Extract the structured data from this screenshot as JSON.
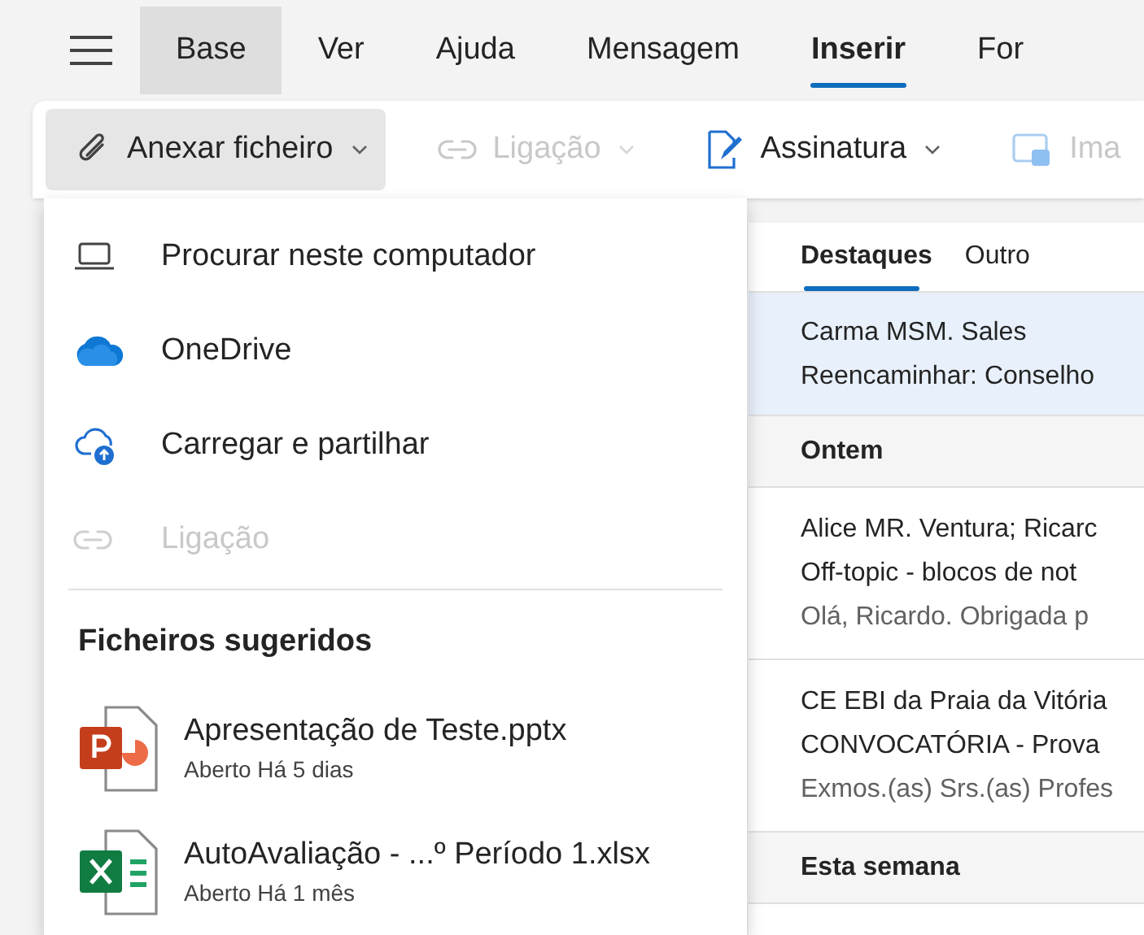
{
  "menu_tabs": [
    {
      "label": "Base",
      "selected": false,
      "hovered": true
    },
    {
      "label": "Ver",
      "selected": false,
      "hovered": false
    },
    {
      "label": "Ajuda",
      "selected": false,
      "hovered": false
    },
    {
      "label": "Mensagem",
      "selected": false,
      "hovered": false
    },
    {
      "label": "Inserir",
      "selected": true,
      "hovered": false
    },
    {
      "label": "For",
      "selected": false,
      "hovered": false
    }
  ],
  "ribbon": [
    {
      "label": "Anexar ficheiro",
      "kind": "paperclip",
      "disabled": false,
      "pressed": true
    },
    {
      "label": "Ligação",
      "kind": "link",
      "disabled": true,
      "pressed": false
    },
    {
      "label": "Assinatura",
      "kind": "signature",
      "disabled": false,
      "pressed": false
    },
    {
      "label": "Ima",
      "kind": "image",
      "disabled": true,
      "pressed": false
    }
  ],
  "attach_menu": {
    "items": [
      {
        "label": "Procurar neste computador",
        "kind": "laptop",
        "disabled": false
      },
      {
        "label": "OneDrive",
        "kind": "onedrive",
        "disabled": false
      },
      {
        "label": "Carregar e partilhar",
        "kind": "upload",
        "disabled": false
      },
      {
        "label": "Ligação",
        "kind": "link",
        "disabled": true
      }
    ],
    "heading": "Ficheiros sugeridos",
    "files": [
      {
        "name": "Apresentação de Teste.pptx",
        "detail": "Aberto Há 5 dias",
        "kind": "powerpoint"
      },
      {
        "name": "AutoAvaliação - ...º Período 1.xlsx",
        "detail": "Aberto Há 1 mês",
        "kind": "excel"
      }
    ]
  },
  "mail_list": {
    "tabs": [
      {
        "label": "Destaques",
        "selected": true
      },
      {
        "label": "Outro",
        "selected": false
      }
    ],
    "rows": [
      {
        "kind": "message",
        "selected": true,
        "lines": [
          "Carma MSM. Sales",
          "Reencaminhar: Conselho"
        ]
      },
      {
        "kind": "group",
        "label": "Ontem"
      },
      {
        "kind": "message",
        "selected": false,
        "lines": [
          "Alice MR. Ventura; Ricarc",
          "Off-topic - blocos de not",
          "Olá, Ricardo. Obrigada p"
        ]
      },
      {
        "kind": "message",
        "selected": false,
        "lines": [
          "CE EBI da Praia da Vitória",
          "CONVOCATÓRIA - Prova",
          "Exmos.(as) Srs.(as) Profes"
        ]
      },
      {
        "kind": "group",
        "label": "Esta semana"
      }
    ]
  }
}
